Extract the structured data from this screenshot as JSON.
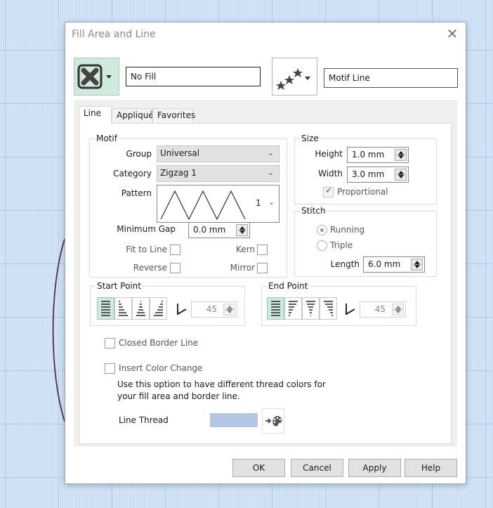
{
  "dialog": {
    "title": "Fill Area and Line",
    "close_icon": "close-icon"
  },
  "header": {
    "fill_type_icon": "no-fill-x-icon",
    "fill_name": "No Fill",
    "line_type_icon": "motif-stars-icon",
    "line_name": "Motif Line"
  },
  "tabs": [
    {
      "label": "Line",
      "active": true
    },
    {
      "label": "Appliqué",
      "active": false
    },
    {
      "label": "Favorites",
      "active": false
    }
  ],
  "motif": {
    "legend": "Motif",
    "group_label": "Group",
    "group_value": "Universal",
    "category_label": "Category",
    "category_value": "Zigzag 1",
    "pattern_label": "Pattern",
    "pattern_value": "1",
    "min_gap_label": "Minimum Gap",
    "min_gap_value": "0.0 mm",
    "fit_to_line_label": "Fit to Line",
    "fit_to_line_checked": false,
    "kern_label": "Kern",
    "kern_checked": false,
    "reverse_label": "Reverse",
    "reverse_checked": false,
    "mirror_label": "Mirror",
    "mirror_checked": false
  },
  "size": {
    "legend": "Size",
    "height_label": "Height",
    "height_value": "1.0 mm",
    "width_label": "Width",
    "width_value": "3.0 mm",
    "proportional_label": "Proportional",
    "proportional_checked": true
  },
  "stitch": {
    "legend": "Stitch",
    "running_label": "Running",
    "triple_label": "Triple",
    "selected": "Running",
    "length_label": "Length",
    "length_value": "6.0 mm"
  },
  "start_point": {
    "legend": "Start Point",
    "styles": [
      "square",
      "left-taper",
      "center-taper",
      "right-taper"
    ],
    "selected_index": 0,
    "angle_value": "45"
  },
  "end_point": {
    "legend": "End Point",
    "styles": [
      "square",
      "left-taper",
      "center-taper",
      "right-taper"
    ],
    "selected_index": 0,
    "angle_value": "45"
  },
  "options": {
    "closed_border_label": "Closed Border Line",
    "closed_border_checked": false,
    "insert_color_change_label": "Insert Color Change",
    "insert_color_change_checked": false,
    "description": "Use this option to have different thread colors for your fill area and border line.",
    "line_thread_label": "Line Thread",
    "line_thread_color": "#b4c6e4"
  },
  "buttons": {
    "ok": "OK",
    "cancel": "Cancel",
    "apply": "Apply",
    "help": "Help"
  },
  "colors": {
    "accent_selected": "#cfeadd",
    "background_grid": "#c9def4"
  }
}
